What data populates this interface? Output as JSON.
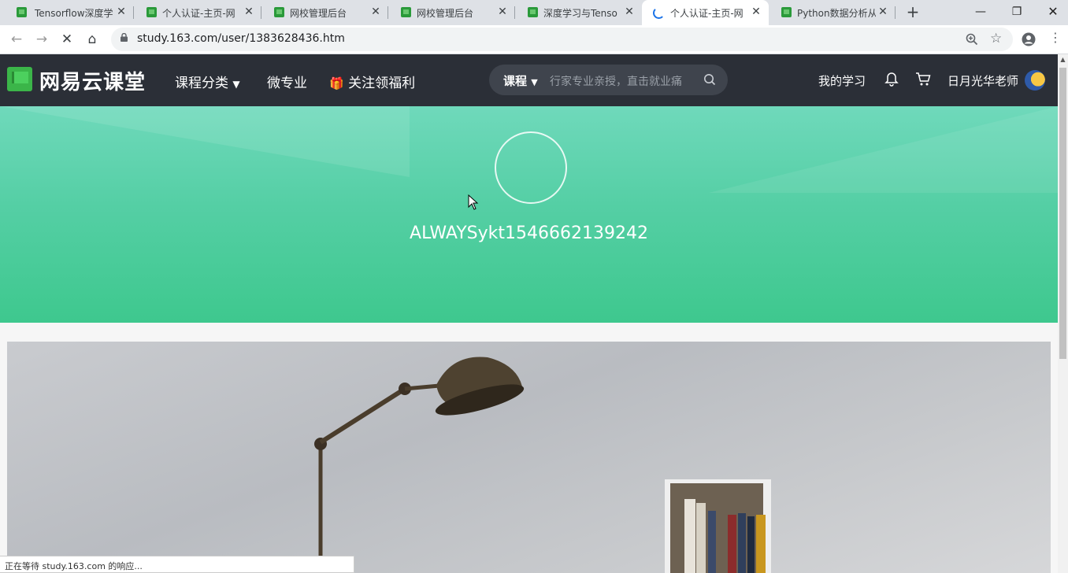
{
  "tabs": [
    {
      "title": "Tensorflow深度学",
      "active": false
    },
    {
      "title": "个人认证-主页-网",
      "active": false
    },
    {
      "title": "网校管理后台",
      "active": false
    },
    {
      "title": "网校管理后台",
      "active": false
    },
    {
      "title": "深度学习与Tenso",
      "active": false
    },
    {
      "title": "个人认证-主页-网",
      "active": true
    },
    {
      "title": "Python数据分析从",
      "active": false
    }
  ],
  "browser": {
    "url": "study.163.com/user/1383628436.htm",
    "status": "正在等待 study.163.com 的响应..."
  },
  "site": {
    "logo": "网易云课堂",
    "nav": {
      "categories": "课程分类",
      "micro": "微专业",
      "welfare": "关注领福利"
    },
    "search": {
      "category": "课程",
      "placeholder": "行家专业亲授，直击就业痛"
    },
    "header_right": {
      "my_learning": "我的学习",
      "user_name": "日月光华老师"
    }
  },
  "profile": {
    "username": "ALWAYSykt1546662139242"
  },
  "colors": {
    "header_bg": "#2b2f37",
    "banner_top": "#6fd9bb",
    "banner_bottom": "#3ec88e",
    "brand_green": "#3bb549"
  }
}
